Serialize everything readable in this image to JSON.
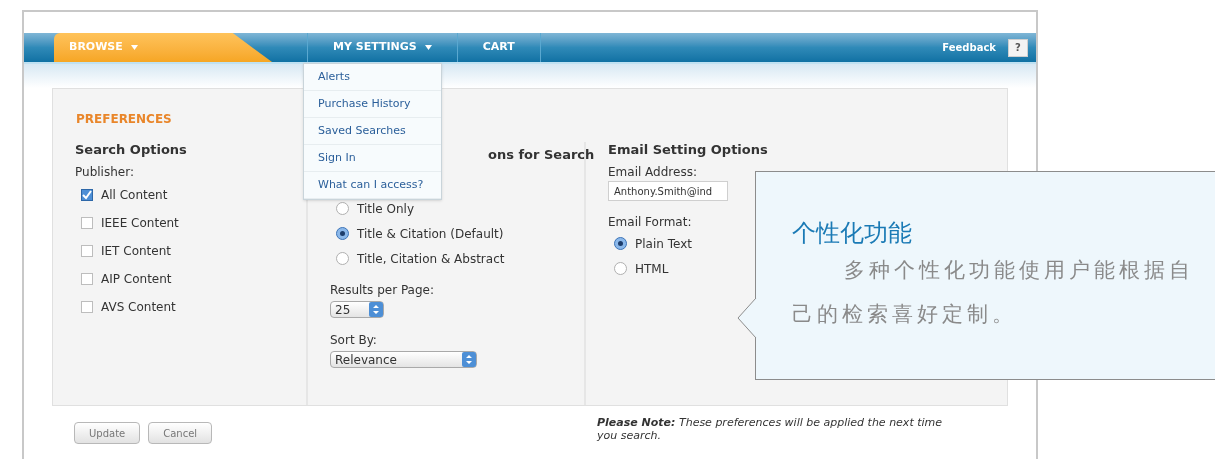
{
  "nav": {
    "tabs": [
      {
        "label": "BROWSE",
        "selected": true,
        "caret": true
      },
      {
        "label": "MY SETTINGS",
        "selected": false,
        "caret": true
      },
      {
        "label": "CART",
        "selected": false,
        "caret": false
      }
    ],
    "feedback": "Feedback",
    "help": "?"
  },
  "menu": {
    "items": [
      "Alerts",
      "Purchase History",
      "Saved Searches",
      "Sign In",
      "What can I access?"
    ]
  },
  "preferences": {
    "title": "PREFERENCES",
    "search_options": {
      "heading": "Search Options",
      "publisher_label": "Publisher:",
      "publishers": [
        {
          "label": "All Content",
          "checked": true
        },
        {
          "label": "IEEE Content",
          "checked": false
        },
        {
          "label": "IET Content",
          "checked": false
        },
        {
          "label": "AIP Content",
          "checked": false
        },
        {
          "label": "AVS Content",
          "checked": false
        }
      ]
    },
    "display_options": {
      "heading": "ons for Search",
      "layouts": [
        {
          "label": "Title Only",
          "selected": false
        },
        {
          "label": "Title & Citation (Default)",
          "selected": true
        },
        {
          "label": "Title, Citation & Abstract",
          "selected": false
        }
      ],
      "per_page_label": "Results per Page:",
      "per_page": "25",
      "sort_label": "Sort By:",
      "sort": "Relevance"
    },
    "email_options": {
      "heading": "Email Setting Options",
      "address_label": "Email Address:",
      "address": "Anthony.Smith@ind",
      "format_label": "Email Format:",
      "formats": [
        {
          "label": "Plain Text",
          "selected": true
        },
        {
          "label": "HTML",
          "selected": false
        }
      ]
    },
    "buttons": [
      "Update",
      "Cancel"
    ],
    "note": "**Please Note:** These preferences will be applied the next time you search."
  },
  "callout": {
    "title": "个性化功能",
    "body": "多种个性化功能使用户能根据自己的检索喜好定制。"
  }
}
